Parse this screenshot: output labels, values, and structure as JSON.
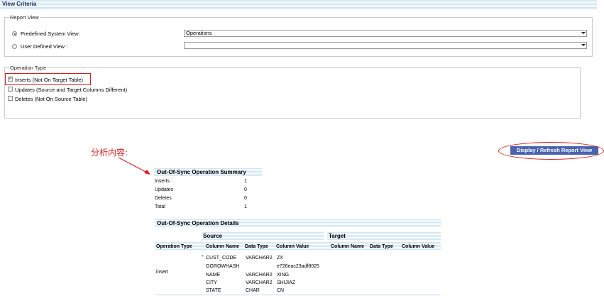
{
  "header": {
    "title": "View Criteria"
  },
  "report_view": {
    "legend": "Report View",
    "options": [
      {
        "label": "Predefined System View:",
        "selected": true,
        "value": "Operations"
      },
      {
        "label": "User Defined View :",
        "selected": false,
        "value": ""
      }
    ]
  },
  "operation_type": {
    "legend": "Operation Type",
    "items": [
      {
        "label": "Inserts (Not On Target Table)",
        "checked": true
      },
      {
        "label": "Updates (Source and Target Columns Different)",
        "checked": false
      },
      {
        "label": "Deletes (Not On Source Table)",
        "checked": false
      }
    ]
  },
  "annotation": "分析内容:",
  "refresh_button": "Display / Refresh Report View",
  "summary": {
    "title": "Out-Of-Sync Operation Summary",
    "rows": [
      {
        "label": "Inserts",
        "value": "1"
      },
      {
        "label": "Updates",
        "value": "0"
      },
      {
        "label": "Deletes",
        "value": "0"
      },
      {
        "label": "Total",
        "value": "1"
      }
    ]
  },
  "details": {
    "title": "Out-Of-Sync Operation Details",
    "source_label": "Source",
    "target_label": "Target",
    "headers": {
      "operation_type": "Operation Type",
      "column_name": "Column Name",
      "data_type": "Data Type",
      "column_value": "Column Value",
      "t_column_name": "Column Name",
      "t_data_type": "Data Type",
      "t_column_value": "Column Value"
    },
    "operation": "insert",
    "rows": [
      {
        "key": "*",
        "name": "CUST_CODE",
        "type": "VARCHAR2",
        "value": "ZX"
      },
      {
        "key": "",
        "name": "GGROWHASH",
        "type": "",
        "value": "e726eac23adf8025"
      },
      {
        "key": "",
        "name": "NAME",
        "type": "VARCHAR2",
        "value": "XING"
      },
      {
        "key": "",
        "name": "CITY",
        "type": "VARCHAR2",
        "value": "SHIJIAZ"
      },
      {
        "key": "",
        "name": "STATE",
        "type": "CHAR",
        "value": "CN"
      }
    ]
  },
  "colors": {
    "highlight_red": "#e01c1c",
    "button_blue": "#4a63b0",
    "header_blue": "#cfe6f6"
  }
}
